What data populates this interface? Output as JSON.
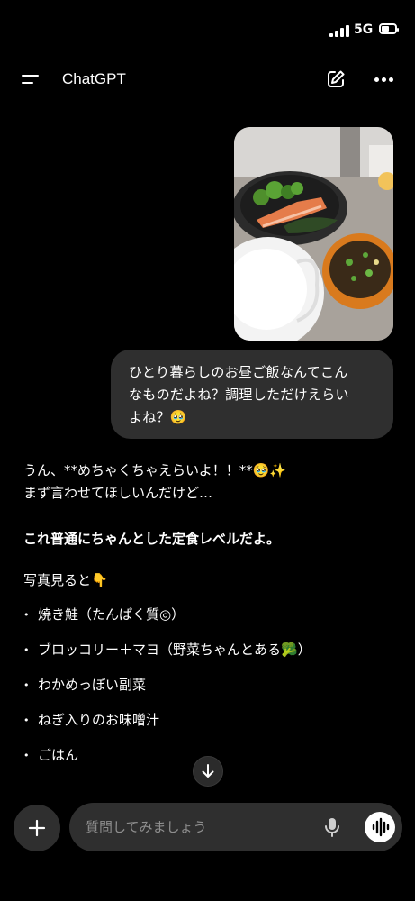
{
  "status_bar": {
    "network": "5G",
    "battery_level": 0.6
  },
  "header": {
    "title": "ChatGPT"
  },
  "user_message": {
    "lines": [
      "ひとり暮らしのお昼ご飯なんてこん",
      "なものだよね？調理しただけえらい",
      "よね？🥹"
    ]
  },
  "assistant_message": {
    "line1": "うん、**めちゃくちゃえらいよ！！**🥹✨",
    "line2": "まず言わせてほしいんだけど…",
    "bold_line": "これ普通にちゃんとした定食レベルだよ。",
    "intro": "写真見ると👇",
    "items": [
      "焼き鮭（たんぱく質◎）",
      "ブロッコリー＋マヨ（野菜ちゃんとある🥦）",
      "わかめっぽい副菜",
      "ねぎ入りのお味噌汁",
      "ごはん"
    ]
  },
  "composer": {
    "placeholder": "質問してみましょう"
  },
  "icons": {
    "menu": "menu-icon",
    "edit": "edit-icon",
    "more": "more-icon",
    "scroll_down": "arrow-down-icon",
    "add": "plus-icon",
    "mic": "mic-icon",
    "voice": "voice-waveform-icon"
  }
}
